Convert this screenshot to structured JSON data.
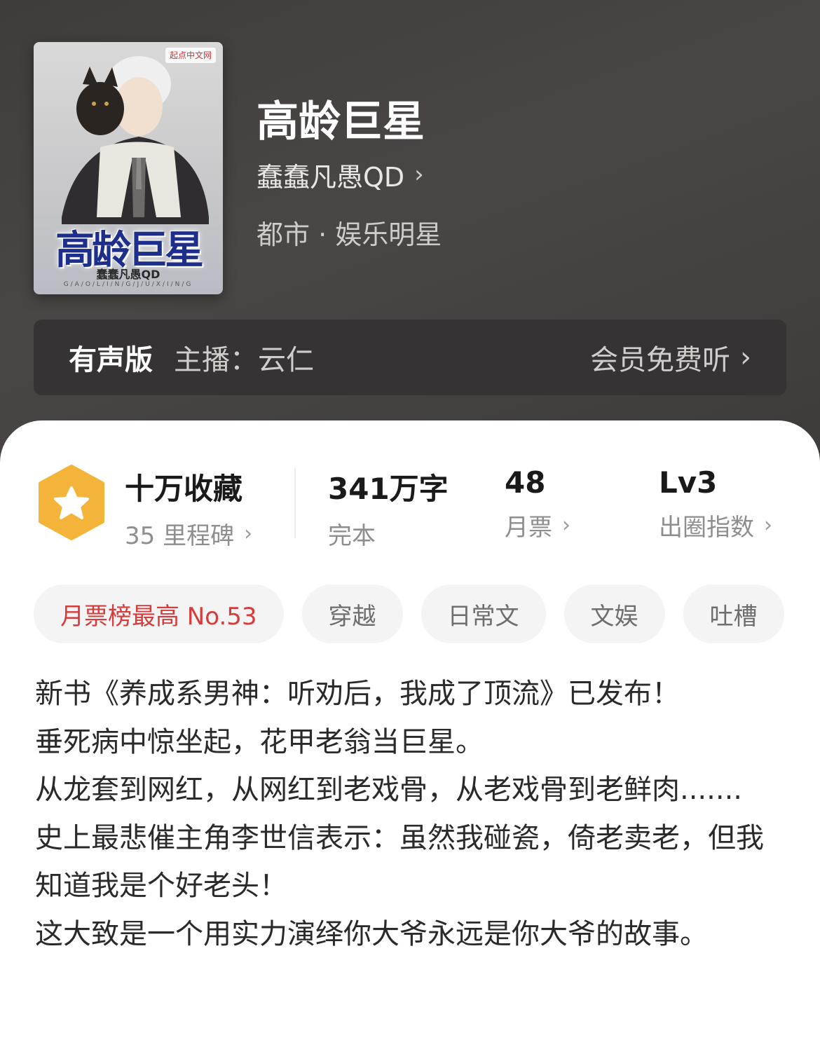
{
  "book": {
    "title": "高龄巨星",
    "author": "蠢蠢凡愚QD",
    "genre": "都市 · 娱乐明星"
  },
  "cover": {
    "publisher": "起点中文网",
    "title": "高龄巨星",
    "author": "蠢蠢凡愚QD",
    "subtitle": "G/A/O/L/I/N/G/J/U/X/I/N/G"
  },
  "audio": {
    "label": "有声版",
    "host": "主播：云仁",
    "vip": "会员免费听"
  },
  "stats": {
    "favorites": {
      "main": "十万收藏",
      "sub": "35 里程碑"
    },
    "words": {
      "main": "341万字",
      "sub": "完本"
    },
    "tickets": {
      "main": "48",
      "sub": "月票"
    },
    "influence": {
      "main": "Lv3",
      "sub": "出圈指数"
    }
  },
  "tags": [
    "月票榜最高 No.53",
    "穿越",
    "日常文",
    "文娱",
    "吐槽"
  ],
  "description": [
    "新书《养成系男神：听劝后，我成了顶流》已发布！",
    "垂死病中惊坐起，花甲老翁当巨星。",
    "从龙套到网红，从网红到老戏骨，从老戏骨到老鲜肉.......",
    "史上最悲催主角李世信表示：虽然我碰瓷，倚老卖老，但我知道我是个好老头！",
    "这大致是一个用实力演绎你大爷永远是你大爷的故事。"
  ],
  "colors": {
    "header_bg": "#454141",
    "audio_bar_bg": "#353333",
    "badge": "#f4b43a",
    "hot_tag_text": "#d63c3c",
    "tag_bg": "#f4f4f4"
  },
  "icons": {
    "chevron": "chevron-right-icon",
    "badge": "star-hexagon-icon"
  }
}
